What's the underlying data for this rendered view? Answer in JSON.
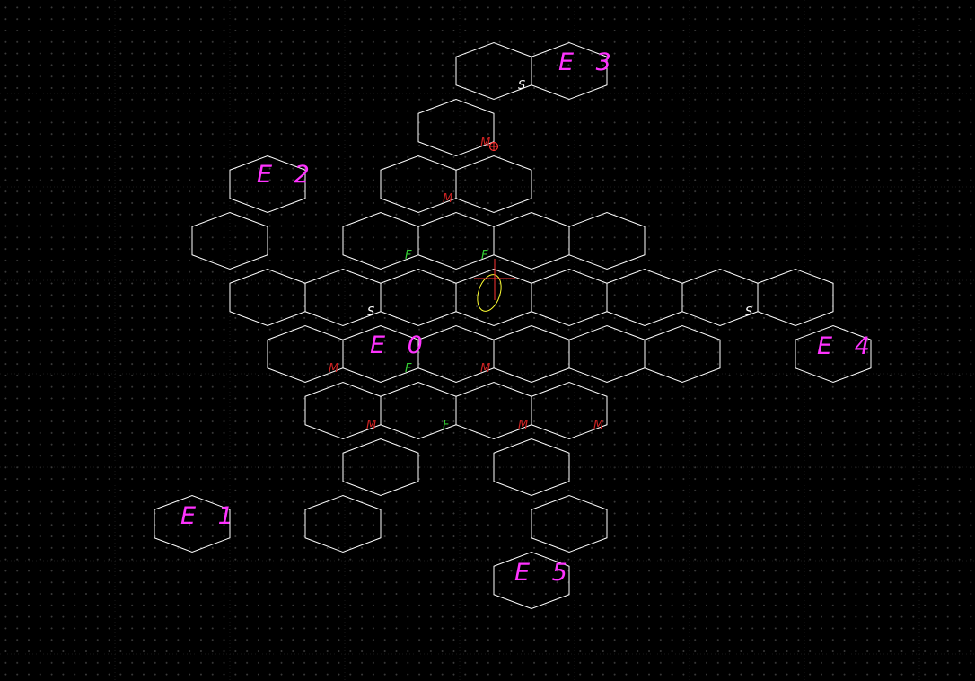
{
  "colors": {
    "background": "#000000",
    "hex_stroke": "#ffffff",
    "entrance_label": "#ff33ff",
    "tag_S": "#ffffff",
    "tag_F": "#33cc33",
    "tag_M": "#cc2222",
    "cursor": "#ff3333",
    "ellipse": "#ffff33"
  },
  "entrances": [
    {
      "label": "E 0",
      "row": 0,
      "col": 0
    },
    {
      "label": "E 1",
      "row": 0,
      "col": 0
    },
    {
      "label": "E 2",
      "row": 0,
      "col": 0
    },
    {
      "label": "E 3",
      "row": 0,
      "col": 0
    },
    {
      "label": "E 4",
      "row": 0,
      "col": 0
    },
    {
      "label": "E 5",
      "row": 0,
      "col": 0
    }
  ],
  "tags": [
    {
      "text": "S",
      "kind": "S"
    },
    {
      "text": "S",
      "kind": "S"
    },
    {
      "text": "S",
      "kind": "S"
    },
    {
      "text": "F",
      "kind": "F"
    },
    {
      "text": "F",
      "kind": "F"
    },
    {
      "text": "F",
      "kind": "F"
    },
    {
      "text": "F",
      "kind": "F"
    },
    {
      "text": "M",
      "kind": "M"
    },
    {
      "text": "M",
      "kind": "M"
    },
    {
      "text": "M",
      "kind": "M"
    },
    {
      "text": "M",
      "kind": "M"
    },
    {
      "text": "M",
      "kind": "M"
    },
    {
      "text": "M",
      "kind": "M"
    },
    {
      "text": "M",
      "kind": "M"
    }
  ]
}
